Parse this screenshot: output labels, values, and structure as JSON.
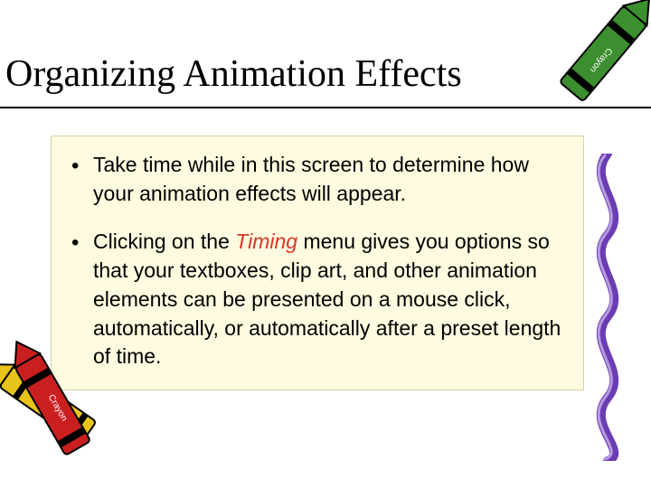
{
  "title": "Organizing Animation Effects",
  "bullets": [
    {
      "before": "Take time while in this screen to determine how your animation effects will appear.",
      "keyword": "",
      "after": ""
    },
    {
      "before": "Clicking on the ",
      "keyword": "Timing",
      "after": " menu gives you options so that your textboxes, clip art, and other animation elements can be presented on a mouse click, automatically, or automatically after a preset length of time."
    }
  ],
  "icons": {
    "crayon_green": "green-crayon-icon",
    "crayon_red": "red-crayon-icon",
    "squiggle": "purple-squiggle-icon"
  },
  "colors": {
    "keyword": "#d9362a",
    "content_bg": "#fffbe0",
    "content_border": "#d6cfa3",
    "squiggle": "#6a3db3"
  }
}
